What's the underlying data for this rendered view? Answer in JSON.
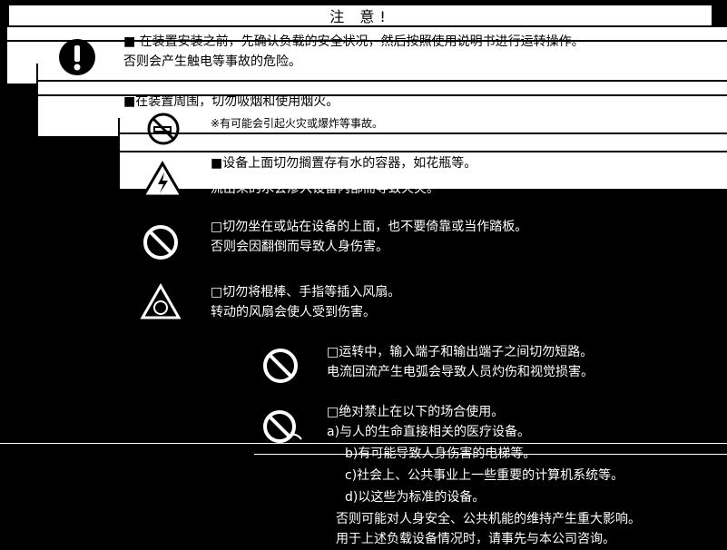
{
  "notice": {
    "title": "注 意!",
    "sections": [
      {
        "icon": "exclamation-icon",
        "lines": [
          "■ 在装置安装之前，先确认负载的安全状况，然后按照使用说明书进行运转操作。",
          "否则会产生触电等事故的危险。"
        ]
      },
      {
        "icon": "no-smoking-icon",
        "lines": [
          "■在装置周围，切勿吸烟和使用烟火。",
          "※有可能会引起火灾或爆炸等事故。"
        ]
      },
      {
        "icon": "electric-shock-warning-icon",
        "lines": [
          "■设备上面切勿搁置存有水的容器，如花瓶等。",
          "流出来的水会渗入设备内部而导致火灾。"
        ]
      },
      {
        "icon": "prohibition-icon",
        "lines": [
          "□切勿坐在或站在设备的上面，也不要倚靠或当作踏板。",
          "否则会因翻倒而导致人身伤害。"
        ]
      },
      {
        "icon": "fan-warning-icon",
        "lines": [
          "□切勿将棍棒、手指等插入风扇。",
          "转动的风扇会使人受到伤害。"
        ]
      },
      {
        "icon": "prohibition-icon",
        "lines": [
          "□运转中，输入端子和输出端子之间切勿短路。",
          "电流回流产生电弧会导致人员灼伤和视觉损害。"
        ]
      },
      {
        "icon": "no-use-icon",
        "lines": [
          "□绝对禁止在以下的场合使用。",
          "a)与人的生命直接相关的医疗设备。",
          "b)有可能导致人身伤害的电梯等。",
          "c)社会上、公共事业上一些重要的计算机系统等。",
          "d)以这些为标准的设备。",
          "否则可能对人身安全、公共机能的维持产生重大影响。",
          "用于上述负载设备情况时，请事先与本公司咨询。"
        ]
      }
    ]
  }
}
